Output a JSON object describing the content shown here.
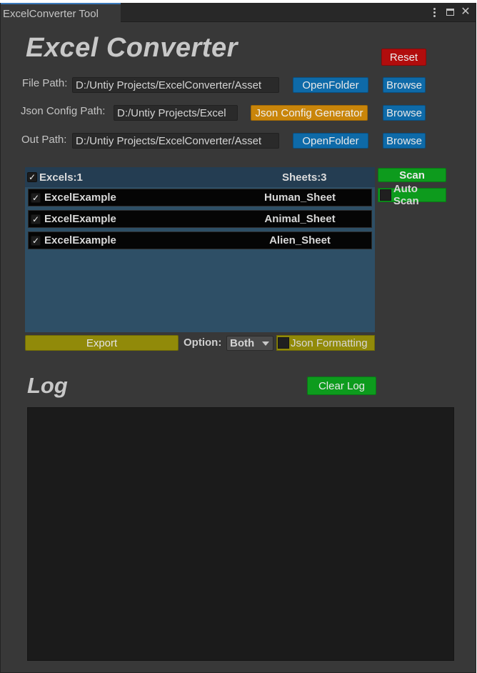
{
  "window": {
    "tab_title": "ExcelConverter Tool"
  },
  "header": {
    "title": "Excel Converter",
    "reset_label": "Reset"
  },
  "paths": {
    "file_path": {
      "label": "File Path:",
      "value": "D:/Untiy Projects/ExcelConverter/Asset",
      "open_label": "OpenFolder",
      "browse_label": "Browse"
    },
    "json_config_path": {
      "label": "Json Config Path:",
      "value": "D:/Untiy Projects/Excel",
      "generator_label": "Json Config Generator",
      "browse_label": "Browse"
    },
    "out_path": {
      "label": "Out Path:",
      "value": "D:/Untiy Projects/ExcelConverter/Asset",
      "open_label": "OpenFolder",
      "browse_label": "Browse"
    }
  },
  "excel_list": {
    "header_excels": "Excels:1",
    "header_sheets": "Sheets:3",
    "all_checked": true,
    "rows": [
      {
        "excel": "ExcelExample",
        "sheet": "Human_Sheet",
        "checked": true
      },
      {
        "excel": "ExcelExample",
        "sheet": "Animal_Sheet",
        "checked": true
      },
      {
        "excel": "ExcelExample",
        "sheet": "Alien_Sheet",
        "checked": true
      }
    ]
  },
  "scan": {
    "scan_label": "Scan",
    "auto_scan_label": "Auto Scan",
    "auto_scan_checked": false
  },
  "export": {
    "export_label": "Export",
    "option_label": "Option:",
    "option_value": "Both",
    "json_formatting_label": "Json Formatting",
    "json_formatting_checked": false
  },
  "log": {
    "title": "Log",
    "clear_label": "Clear Log"
  },
  "colors": {
    "reset": "#b10d0d",
    "browse": "#0e6aa8",
    "generator": "#c9850a",
    "scan": "#0d9b1d",
    "export": "#918a09",
    "list_bg": "#2e4f66"
  },
  "icons": {
    "tab_menu": "kebab-menu-icon",
    "maximize": "maximize-icon",
    "close": "close-icon",
    "check": "checkmark-icon",
    "dropdown": "caret-down-icon"
  }
}
